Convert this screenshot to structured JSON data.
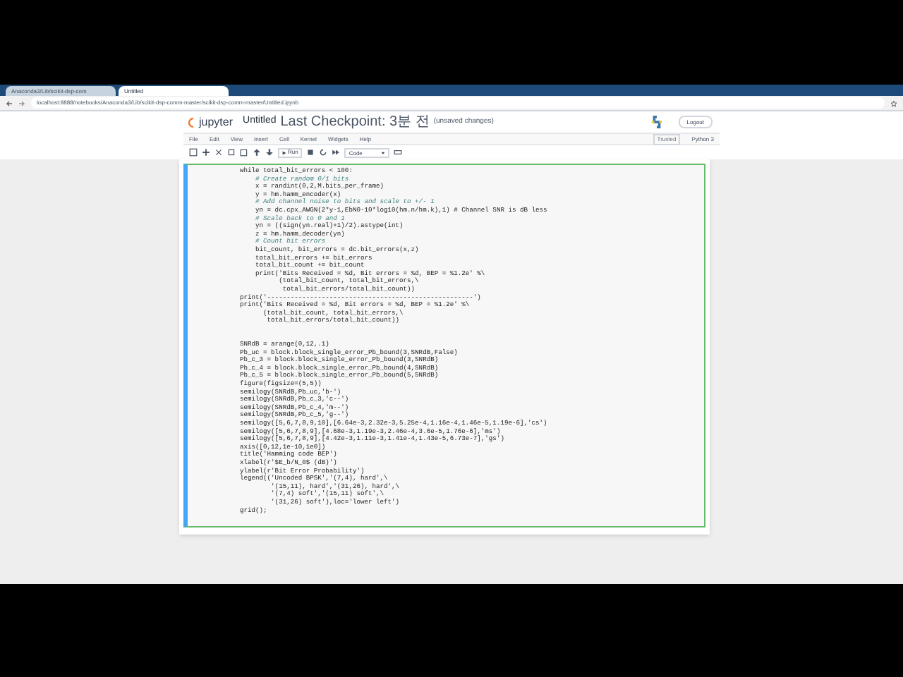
{
  "browser": {
    "tabs": [
      {
        "label": "Anaconda3/Lib/scikit-dsp-com",
        "selected": false
      },
      {
        "label": "Untitled",
        "selected": true
      }
    ],
    "url": "localhost:8888/notebooks/Anaconda3/Lib/scikit-dsp-comm-master/scikit-dsp-comm-master/Untitled.ipynb"
  },
  "notebook": {
    "logo": "jupyter",
    "title": "Untitled",
    "checkpoint": "Last Checkpoint: 3분 전",
    "unsaved": "(unsaved changes)",
    "logout": "Logout",
    "trusted": "Trusted",
    "kernel": "Python 3"
  },
  "menu": [
    "File",
    "Edit",
    "View",
    "Insert",
    "Cell",
    "Kernel",
    "Widgets",
    "Help"
  ],
  "toolbar": {
    "run": "Run",
    "cell_type": "Code"
  },
  "code": [
    {
      "kind": "code",
      "text": "while total_bit_errors < 100:"
    },
    {
      "kind": "comment",
      "text": "    # Create random 0/1 bits"
    },
    {
      "kind": "code",
      "text": "    x = randint(0,2,M.bits_per_frame)"
    },
    {
      "kind": "code",
      "text": "    y = hm.hamm_encoder(x)"
    },
    {
      "kind": "comment",
      "text": "    # Add channel noise to bits and scale to +/- 1"
    },
    {
      "kind": "code",
      "text": "    yn = dc.cpx_AWGN(2*y-1,EbN0-10*log10(hm.n/hm.k),1) # Channel SNR is dB less"
    },
    {
      "kind": "comment",
      "text": "    # Scale back to 0 and 1"
    },
    {
      "kind": "code",
      "text": "    yn = ((sign(yn.real)+1)/2).astype(int)"
    },
    {
      "kind": "code",
      "text": "    z = hm.hamm_decoder(yn)"
    },
    {
      "kind": "comment",
      "text": "    # Count bit errors"
    },
    {
      "kind": "code",
      "text": "    bit_count, bit_errors = dc.bit_errors(x,z)"
    },
    {
      "kind": "code",
      "text": "    total_bit_errors += bit_errors"
    },
    {
      "kind": "code",
      "text": "    total_bit_count += bit_count"
    },
    {
      "kind": "code",
      "text": "    print('Bits Received = %d, Bit errors = %d, BEP = %1.2e' %\\"
    },
    {
      "kind": "code",
      "text": "          (total_bit_count, total_bit_errors,\\"
    },
    {
      "kind": "code",
      "text": "           total_bit_errors/total_bit_count))"
    },
    {
      "kind": "code",
      "text": "print('-----------------------------------------------------')"
    },
    {
      "kind": "code",
      "text": "print('Bits Received = %d, Bit errors = %d, BEP = %1.2e' %\\"
    },
    {
      "kind": "code",
      "text": "      (total_bit_count, total_bit_errors,\\"
    },
    {
      "kind": "code",
      "text": "       total_bit_errors/total_bit_count))"
    },
    {
      "kind": "blank"
    },
    {
      "kind": "blank"
    },
    {
      "kind": "code",
      "text": "SNRdB = arange(0,12,.1)"
    },
    {
      "kind": "code",
      "text": "Pb_uc = block.block_single_error_Pb_bound(3,SNRdB,False)"
    },
    {
      "kind": "code",
      "text": "Pb_c_3 = block.block_single_error_Pb_bound(3,SNRdB)"
    },
    {
      "kind": "code",
      "text": "Pb_c_4 = block.block_single_error_Pb_bound(4,SNRdB)"
    },
    {
      "kind": "code",
      "text": "Pb_c_5 = block.block_single_error_Pb_bound(5,SNRdB)"
    },
    {
      "kind": "code",
      "text": "figure(figsize=(5,5))"
    },
    {
      "kind": "code",
      "text": "semilogy(SNRdB,Pb_uc,'b-')"
    },
    {
      "kind": "code",
      "text": "semilogy(SNRdB,Pb_c_3,'c--')"
    },
    {
      "kind": "code",
      "text": "semilogy(SNRdB,Pb_c_4,'m--')"
    },
    {
      "kind": "code",
      "text": "semilogy(SNRdB,Pb_c_5,'g--')"
    },
    {
      "kind": "code",
      "text": "semilogy([5,6,7,8,9,10],[6.64e-3,2.32e-3,5.25e-4,1.16e-4,1.46e-5,1.19e-6],'cs')"
    },
    {
      "kind": "code",
      "text": "semilogy([5,6,7,8,9],[4.68e-3,1.19e-3,2.46e-4,3.6e-5,1.76e-6],'ms')"
    },
    {
      "kind": "code",
      "text": "semilogy([5,6,7,8,9],[4.42e-3,1.11e-3,1.41e-4,1.43e-5,6.73e-7],'gs')"
    },
    {
      "kind": "code",
      "text": "axis([0,12,1e-10,1e0])"
    },
    {
      "kind": "code",
      "text": "title('Hamming code BEP')"
    },
    {
      "kind": "code",
      "text": "xlabel(r'$E_b/N_0$ (dB)')"
    },
    {
      "kind": "code",
      "text": "ylabel(r'Bit Error Probability')"
    },
    {
      "kind": "code",
      "text": "legend(('Uncoded BPSK','(7,4), hard',\\"
    },
    {
      "kind": "code",
      "text": "        '(15,11), hard','(31,26), hard',\\"
    },
    {
      "kind": "code",
      "text": "        '(7,4) soft','(15,11) soft',\\"
    },
    {
      "kind": "code",
      "text": "        '(31,26) soft'),loc='lower left')"
    },
    {
      "kind": "code",
      "text": "grid();"
    }
  ]
}
